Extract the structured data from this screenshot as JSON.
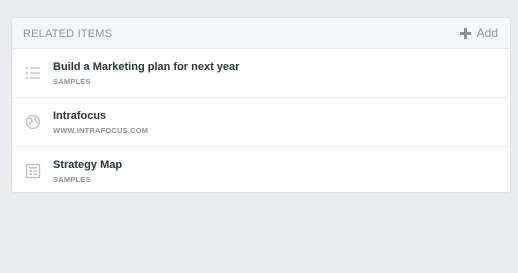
{
  "related_items": {
    "title": "RELATED ITEMS",
    "add_label": "Add",
    "items": [
      {
        "title": "Build a Marketing plan for next year",
        "subtitle": "SAMPLES",
        "icon": "list-icon"
      },
      {
        "title": "Intrafocus",
        "subtitle": "WWW.INTRAFOCUS.COM",
        "icon": "globe-icon"
      },
      {
        "title": "Strategy Map",
        "subtitle": "SAMPLES",
        "icon": "strategy-map-icon"
      }
    ]
  },
  "colors": {
    "background": "#e9ebec",
    "panel": "#ffffff",
    "header_bg": "#f4f6f7",
    "muted_text": "#8a9399",
    "title_text": "#2a3540"
  }
}
